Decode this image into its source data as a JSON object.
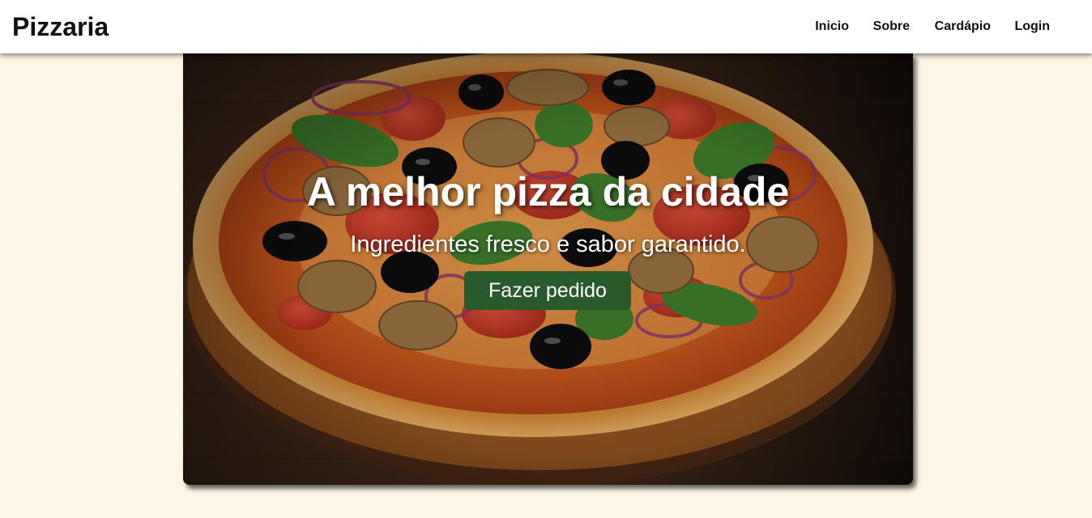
{
  "header": {
    "brand": "Pizzaria",
    "nav": [
      {
        "label": "Inicio"
      },
      {
        "label": "Sobre"
      },
      {
        "label": "Cardápio"
      },
      {
        "label": "Login"
      }
    ]
  },
  "hero": {
    "title": "A melhor pizza da cidade",
    "subtitle": "Ingredientes fresco e sabor garantido.",
    "button_label": "Fazer pedido",
    "image_icon": "pizza-photo"
  },
  "colors": {
    "page_background": "#fdf5e6",
    "header_background": "#ffffff",
    "button_background": "#285a2c",
    "text_on_hero": "#ffffff"
  }
}
